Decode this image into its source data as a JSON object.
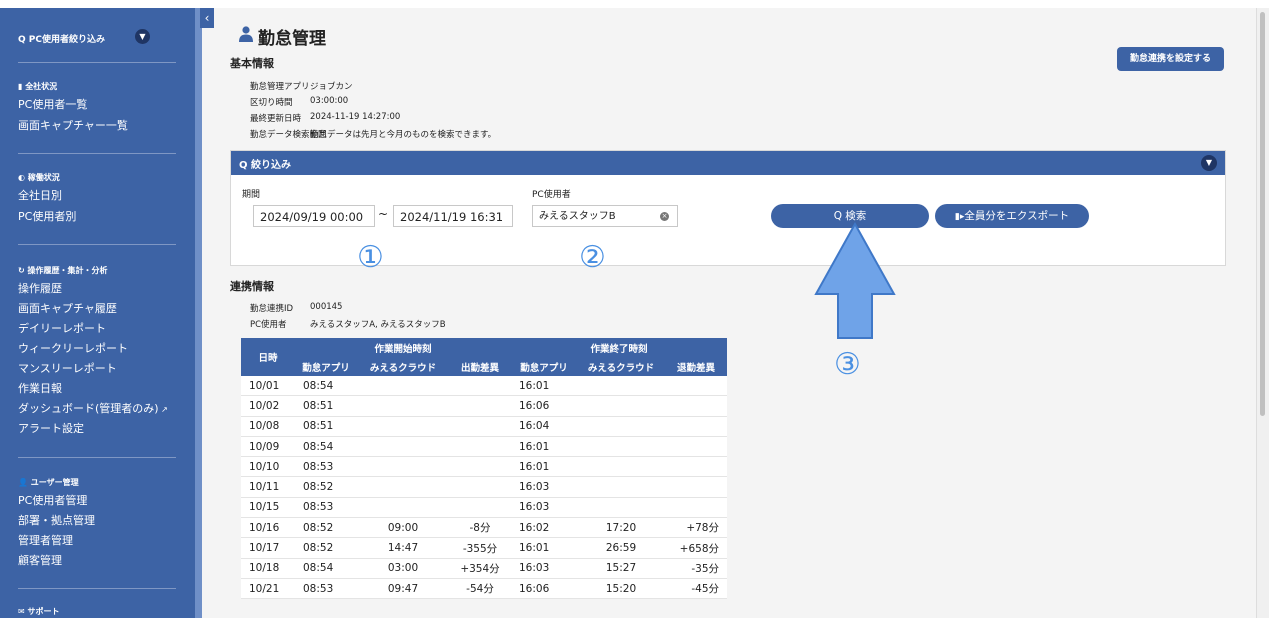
{
  "sidebar": {
    "filter_label": "Q PC使用者絞り込み",
    "sections": [
      {
        "head": "全社状況",
        "items": [
          "PC使用者一覧",
          "画面キャプチャー一覧"
        ]
      },
      {
        "head": "稼働状況",
        "items": [
          "全社日別",
          "PC使用者別"
        ]
      },
      {
        "head": "操作履歴・集計・分析",
        "items": [
          "操作履歴",
          "画面キャプチャ履歴",
          "デイリーレポート",
          "ウィークリーレポート",
          "マンスリーレポート",
          "作業日報",
          "ダッシュボード(管理者のみ)",
          "アラート設定"
        ]
      },
      {
        "head": "ユーザー管理",
        "items": [
          "PC使用者管理",
          "部署・拠点管理",
          "管理者管理",
          "顧客管理"
        ]
      },
      {
        "head": "サポート",
        "items": []
      }
    ]
  },
  "page": {
    "title": "勤怠管理",
    "setting_button": "勤怠連携を設定する",
    "basic_info_title": "基本情報",
    "basic_info": [
      {
        "label": "勤怠管理アプリ",
        "value": "ジョブカン"
      },
      {
        "label": "区切り時間",
        "value": "03:00:00"
      },
      {
        "label": "最終更新日時",
        "value": "2024-11-19 14:27:00"
      },
      {
        "label": "勤怠データ検索範囲",
        "value": "勤怠データは先月と今月のものを検索できます。"
      }
    ]
  },
  "filter": {
    "title": "Q 絞り込み",
    "period_label": "期間",
    "date_from": "2024/09/19 00:00",
    "date_to": "2024/11/19 16:31",
    "tilde": "~",
    "user_label": "PC使用者",
    "user_value": "みえるスタッフB",
    "search_button": "Q 検索",
    "export_button": "全員分をエクスポート"
  },
  "annotations": {
    "n1": "①",
    "n2": "②",
    "n3": "③"
  },
  "link_info": {
    "title": "連携情報",
    "id_label": "勤怠連携ID",
    "id_value": "000145",
    "user_label": "PC使用者",
    "user_value": "みえるスタッフA, みえるスタッフB"
  },
  "table": {
    "date_header": "日時",
    "start_group": "作業開始時刻",
    "end_group": "作業終了時刻",
    "sub_headers": [
      "勤怠アプリ",
      "みえるクラウド",
      "出勤差異",
      "勤怠アプリ",
      "みえるクラウド",
      "退勤差異"
    ],
    "rows": [
      [
        "10/01",
        "08:54",
        "",
        "",
        "16:01",
        "",
        ""
      ],
      [
        "10/02",
        "08:51",
        "",
        "",
        "16:06",
        "",
        ""
      ],
      [
        "10/08",
        "08:51",
        "",
        "",
        "16:04",
        "",
        ""
      ],
      [
        "10/09",
        "08:54",
        "",
        "",
        "16:01",
        "",
        ""
      ],
      [
        "10/10",
        "08:53",
        "",
        "",
        "16:01",
        "",
        ""
      ],
      [
        "10/11",
        "08:52",
        "",
        "",
        "16:03",
        "",
        ""
      ],
      [
        "10/15",
        "08:53",
        "",
        "",
        "16:03",
        "",
        ""
      ],
      [
        "10/16",
        "08:52",
        "09:00",
        "-8分",
        "16:02",
        "17:20",
        "+78分"
      ],
      [
        "10/17",
        "08:52",
        "14:47",
        "-355分",
        "16:01",
        "26:59",
        "+658分"
      ],
      [
        "10/18",
        "08:54",
        "03:00",
        "+354分",
        "16:03",
        "15:27",
        "-35分"
      ],
      [
        "10/21",
        "08:53",
        "09:47",
        "-54分",
        "16:06",
        "15:20",
        "-45分"
      ]
    ]
  },
  "colors": {
    "primary": "#3d63a5",
    "dark": "#1f3564",
    "arrow": "#6fa3e8",
    "annotation": "#4a90e2"
  }
}
